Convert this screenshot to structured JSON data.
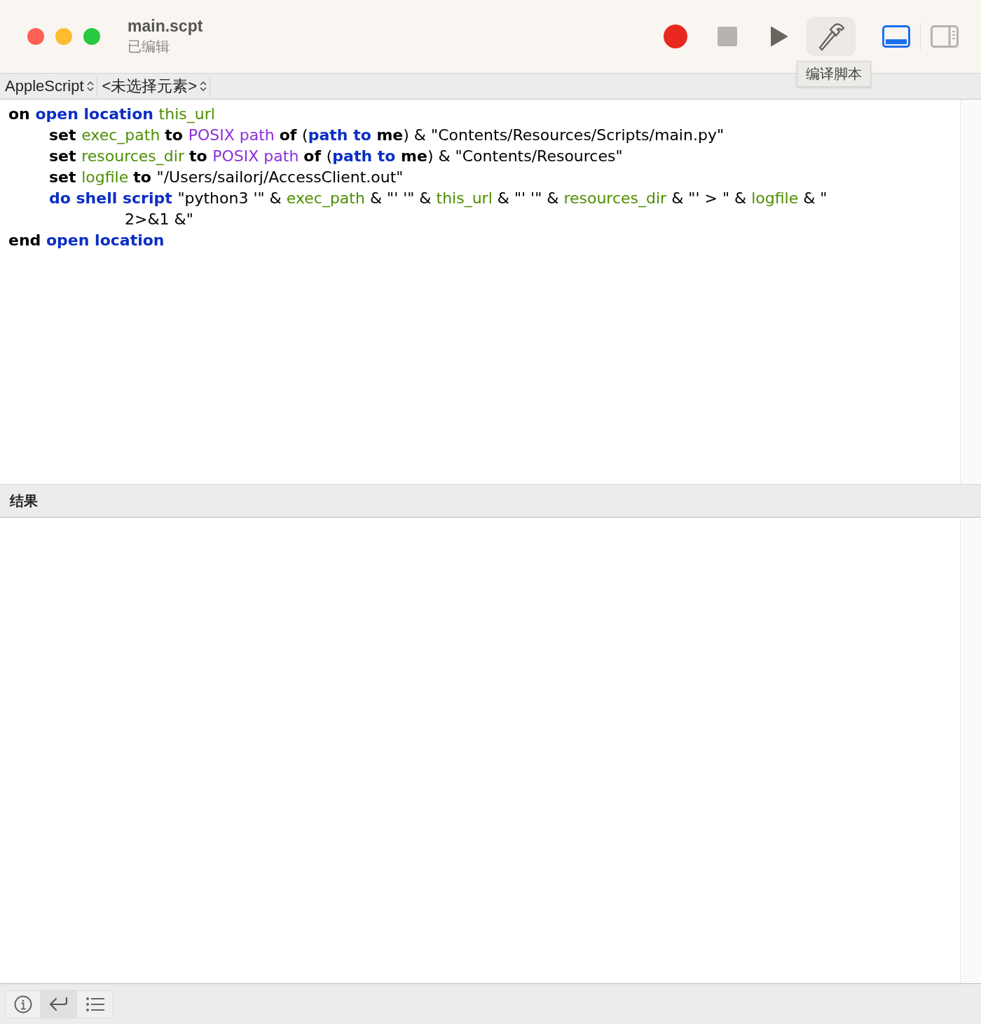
{
  "window": {
    "title": "main.scpt",
    "subtitle": "已编辑"
  },
  "toolbar": {
    "buttons": [
      {
        "kind": "record",
        "highlighted": false
      },
      {
        "kind": "stop",
        "highlighted": false
      },
      {
        "kind": "run",
        "highlighted": false
      },
      {
        "kind": "compile",
        "highlighted": true
      }
    ],
    "tooltip": "编译脚本",
    "view_toggles": [
      {
        "kind": "bottom",
        "selected": true
      },
      {
        "kind": "side",
        "selected": false
      }
    ]
  },
  "navigation_bar": {
    "language": "AppleScript",
    "element": "<未选择元素>"
  },
  "editor": {
    "lines": [
      {
        "tokens": [
          {
            "text": "on ",
            "kind": "keyword"
          },
          {
            "text": "open location ",
            "kind": "command"
          },
          {
            "text": "this_url",
            "kind": "variable"
          }
        ],
        "children": [
          {
            "tokens": [
              {
                "text": "set ",
                "kind": "keyword"
              },
              {
                "text": "exec_path ",
                "kind": "variable"
              },
              {
                "text": "to ",
                "kind": "keyword"
              },
              {
                "text": "POSIX path ",
                "kind": "property"
              },
              {
                "text": "of ",
                "kind": "keyword"
              },
              {
                "text": "(",
                "kind": "plain"
              },
              {
                "text": "path to ",
                "kind": "command"
              },
              {
                "text": "me",
                "kind": "keyword"
              },
              {
                "text": ") & \"Contents/Resources/Scripts/main.py\"",
                "kind": "plain"
              }
            ]
          },
          {
            "tokens": [
              {
                "text": "set ",
                "kind": "keyword"
              },
              {
                "text": "resources_dir ",
                "kind": "variable"
              },
              {
                "text": "to ",
                "kind": "keyword"
              },
              {
                "text": "POSIX path ",
                "kind": "property"
              },
              {
                "text": "of ",
                "kind": "keyword"
              },
              {
                "text": "(",
                "kind": "plain"
              },
              {
                "text": "path to ",
                "kind": "command"
              },
              {
                "text": "me",
                "kind": "keyword"
              },
              {
                "text": ") & \"Contents/Resources\"",
                "kind": "plain"
              }
            ]
          },
          {
            "tokens": [
              {
                "text": "set ",
                "kind": "keyword"
              },
              {
                "text": "logfile ",
                "kind": "variable"
              },
              {
                "text": "to ",
                "kind": "keyword"
              },
              {
                "text": "\"/Users/sailorj/AccessClient.out\"",
                "kind": "plain"
              }
            ]
          },
          {
            "tokens": [
              {
                "text": "do shell script ",
                "kind": "command"
              },
              {
                "text": "\"python3 '\" & ",
                "kind": "plain"
              },
              {
                "text": "exec_path",
                "kind": "variable"
              },
              {
                "text": " & \"' '\" & ",
                "kind": "plain"
              },
              {
                "text": "this_url",
                "kind": "variable"
              },
              {
                "text": " & \"' '\" & ",
                "kind": "plain"
              },
              {
                "text": "resources_dir",
                "kind": "variable"
              },
              {
                "text": " & \"' > \" & ",
                "kind": "plain"
              },
              {
                "text": "logfile",
                "kind": "variable"
              },
              {
                "text": " & \"",
                "kind": "plain"
              }
            ],
            "continuation": [
              {
                "text": "2>&1 &\"",
                "kind": "plain"
              }
            ]
          }
        ]
      },
      {
        "tokens": [
          {
            "text": "end ",
            "kind": "keyword"
          },
          {
            "text": "open location",
            "kind": "command"
          }
        ]
      }
    ]
  },
  "result_panel": {
    "title": "结果"
  },
  "bottom_tabs": [
    {
      "kind": "info",
      "selected": false
    },
    {
      "kind": "reply",
      "selected": true
    },
    {
      "kind": "log",
      "selected": false
    }
  ]
}
